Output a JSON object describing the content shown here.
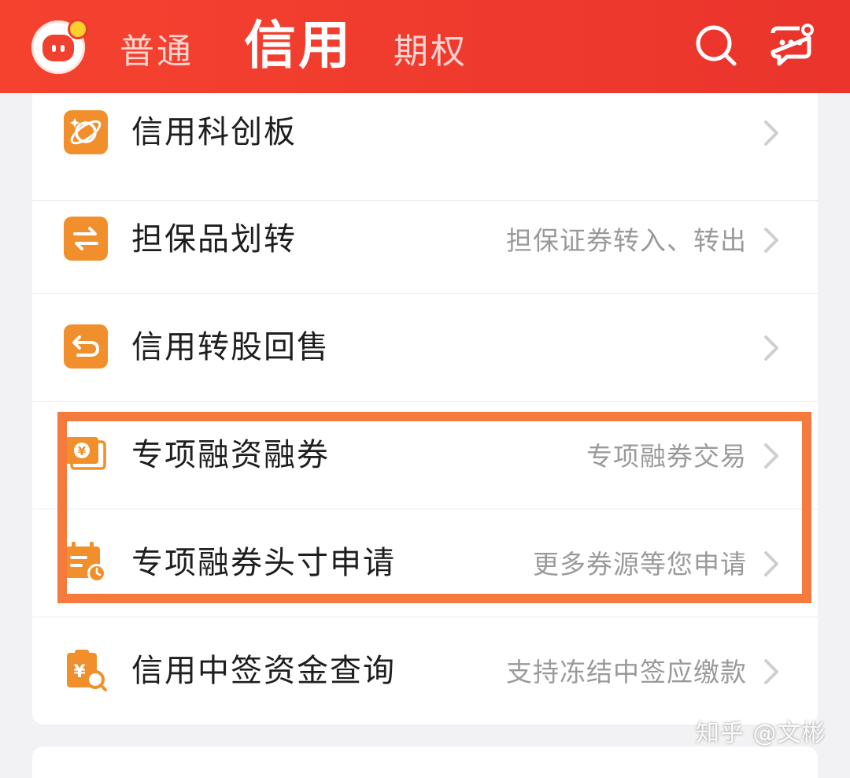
{
  "header": {
    "tabs": [
      {
        "label": "普通",
        "active": false
      },
      {
        "label": "信用",
        "active": true
      },
      {
        "label": "期权",
        "active": false
      }
    ],
    "brand_color": "#ee3a2e",
    "icons": [
      "app-logo-icon",
      "search-icon",
      "message-icon"
    ]
  },
  "menu": {
    "items": [
      {
        "title": "信用科创板",
        "subtitle": "",
        "icon": "planet-icon"
      },
      {
        "title": "担保品划转",
        "subtitle": "担保证券转入、转出",
        "icon": "transfer-arrows-icon"
      },
      {
        "title": "信用转股回售",
        "subtitle": "",
        "icon": "return-arrow-icon"
      },
      {
        "title": "专项融资融券",
        "subtitle": "专项融券交易",
        "icon": "yuan-card-icon"
      },
      {
        "title": "专项融券头寸申请",
        "subtitle": "更多券源等您申请",
        "icon": "calendar-clock-icon"
      },
      {
        "title": "信用中签资金查询",
        "subtitle": "支持冻结中签应缴款",
        "icon": "yuan-search-icon"
      }
    ]
  },
  "annotation": {
    "highlight_color": "#f47a3d"
  },
  "watermark": "知乎 @文彬"
}
